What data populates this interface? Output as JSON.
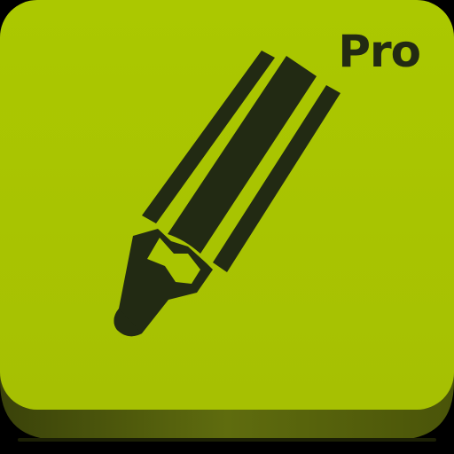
{
  "app_icon": {
    "badge_text": "Pro",
    "icon": "pencil-icon",
    "colors": {
      "face": "#a9c500",
      "side": "#6f7d10",
      "ink": "#222a13",
      "background": "#000000"
    }
  }
}
